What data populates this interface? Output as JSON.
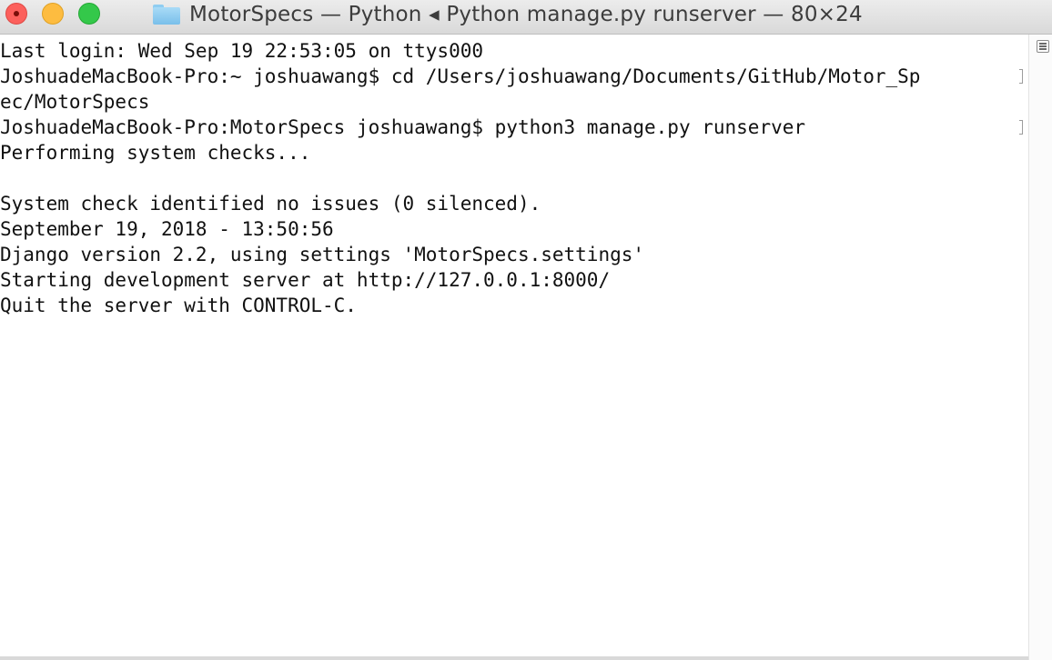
{
  "window": {
    "title": "MotorSpecs — Python ◂ Python manage.py runserver — 80×24",
    "folder_icon": "folder-icon",
    "colors": {
      "close": "#fc605c",
      "minimize": "#fdbc40",
      "maximize": "#34c84a",
      "folder": "#8fcdf1",
      "text": "#111111",
      "cursor": "#9a9a9a"
    }
  },
  "terminal": {
    "lines": [
      "Last login: Wed Sep 19 22:53:05 on ttys000",
      "JoshuadeMacBook-Pro:~ joshuawang$ cd /Users/joshuawang/Documents/GitHub/Motor_Sp",
      "ec/MotorSpecs",
      "JoshuadeMacBook-Pro:MotorSpecs joshuawang$ python3 manage.py runserver",
      "Performing system checks...",
      "",
      "System check identified no issues (0 silenced).",
      "September 19, 2018 - 13:50:56",
      "Django version 2.2, using settings 'MotorSpecs.settings'",
      "Starting development server at http://127.0.0.1:8000/",
      "Quit the server with CONTROL-C."
    ]
  },
  "scrollbar": {
    "menu_icon": "list-menu-icon"
  }
}
